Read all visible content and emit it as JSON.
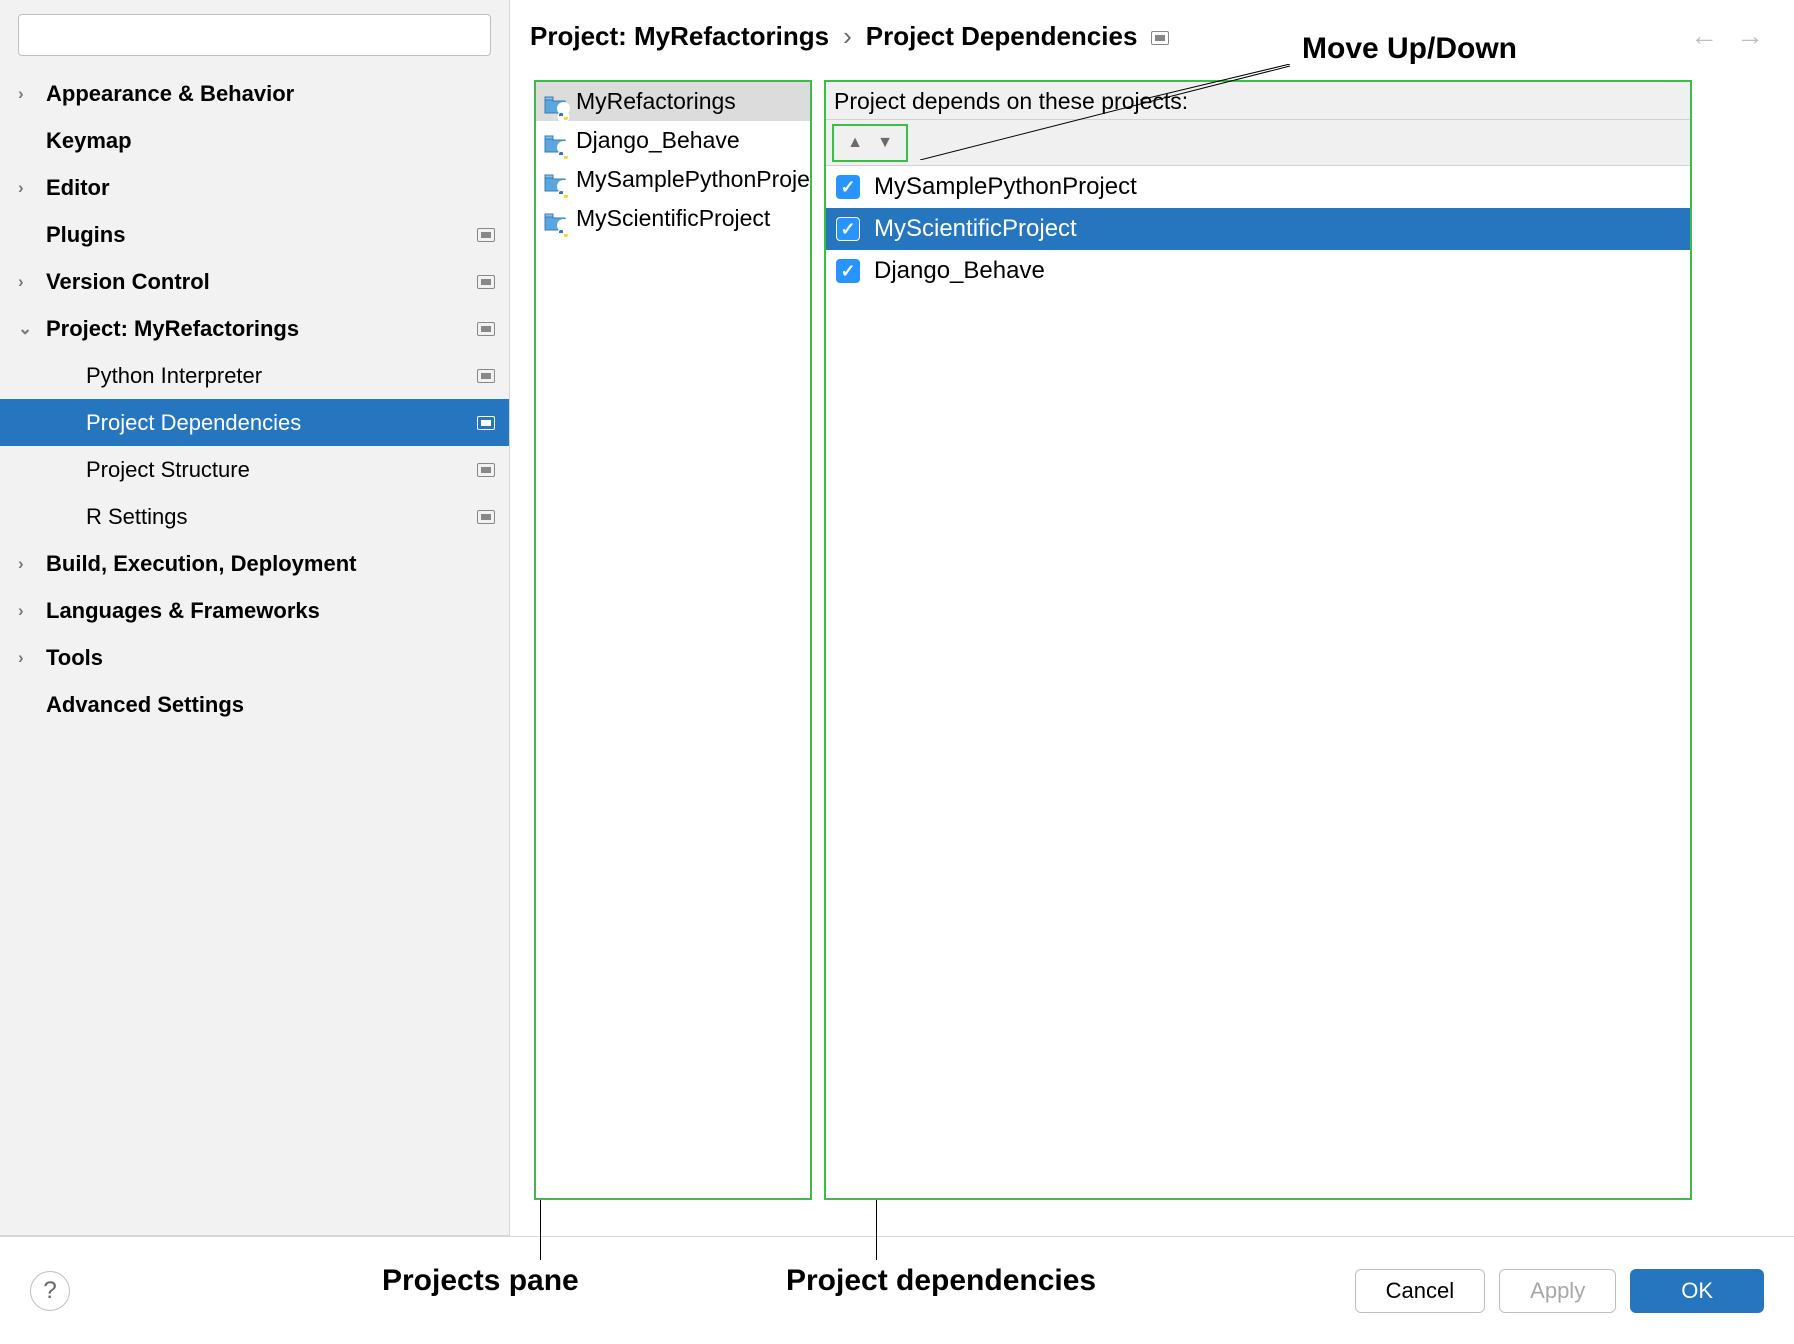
{
  "search": {
    "placeholder": ""
  },
  "sidebar": [
    {
      "label": "Appearance & Behavior",
      "bold": true,
      "chevron": "›",
      "badge": false,
      "sub": false
    },
    {
      "label": "Keymap",
      "bold": true,
      "chevron": "",
      "badge": false,
      "sub": false
    },
    {
      "label": "Editor",
      "bold": true,
      "chevron": "›",
      "badge": false,
      "sub": false
    },
    {
      "label": "Plugins",
      "bold": true,
      "chevron": "",
      "badge": true,
      "sub": false
    },
    {
      "label": "Version Control",
      "bold": true,
      "chevron": "›",
      "badge": true,
      "sub": false
    },
    {
      "label": "Project: MyRefactorings",
      "bold": true,
      "chevron": "⌄",
      "badge": true,
      "sub": false
    },
    {
      "label": "Python Interpreter",
      "bold": false,
      "chevron": "",
      "badge": true,
      "sub": true
    },
    {
      "label": "Project Dependencies",
      "bold": false,
      "chevron": "",
      "badge": true,
      "sub": true,
      "selected": true
    },
    {
      "label": "Project Structure",
      "bold": false,
      "chevron": "",
      "badge": true,
      "sub": true
    },
    {
      "label": "R Settings",
      "bold": false,
      "chevron": "",
      "badge": true,
      "sub": true
    },
    {
      "label": "Build, Execution, Deployment",
      "bold": true,
      "chevron": "›",
      "badge": false,
      "sub": false
    },
    {
      "label": "Languages & Frameworks",
      "bold": true,
      "chevron": "›",
      "badge": false,
      "sub": false
    },
    {
      "label": "Tools",
      "bold": true,
      "chevron": "›",
      "badge": false,
      "sub": false
    },
    {
      "label": "Advanced Settings",
      "bold": true,
      "chevron": "",
      "badge": false,
      "sub": false
    }
  ],
  "breadcrumb": {
    "item1": "Project: MyRefactorings",
    "sep": "›",
    "item2": "Project Dependencies"
  },
  "projects": [
    {
      "name": "MyRefactorings",
      "selected": true
    },
    {
      "name": "Django_Behave",
      "selected": false
    },
    {
      "name": "MySamplePythonProject",
      "selected": false
    },
    {
      "name": "MyScientificProject",
      "selected": false
    }
  ],
  "deps": {
    "header": "Project depends on these projects:",
    "items": [
      {
        "name": "MySamplePythonProject",
        "checked": true,
        "selected": false
      },
      {
        "name": "MyScientificProject",
        "checked": true,
        "selected": true
      },
      {
        "name": "Django_Behave",
        "checked": true,
        "selected": false
      }
    ]
  },
  "buttons": {
    "cancel": "Cancel",
    "apply": "Apply",
    "ok": "OK"
  },
  "annotations": {
    "moveupdown": "Move Up/Down",
    "projectspane": "Projects pane",
    "projectdeps": "Project dependencies"
  }
}
